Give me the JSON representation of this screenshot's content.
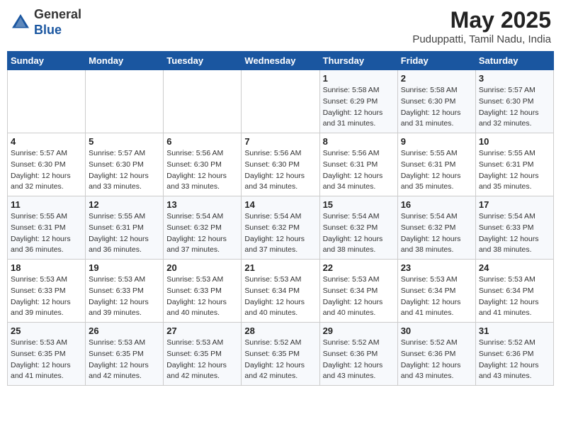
{
  "header": {
    "logo_general": "General",
    "logo_blue": "Blue",
    "month_year": "May 2025",
    "location": "Puduppatti, Tamil Nadu, India"
  },
  "days_of_week": [
    "Sunday",
    "Monday",
    "Tuesday",
    "Wednesday",
    "Thursday",
    "Friday",
    "Saturday"
  ],
  "weeks": [
    [
      {
        "day": "",
        "info": ""
      },
      {
        "day": "",
        "info": ""
      },
      {
        "day": "",
        "info": ""
      },
      {
        "day": "",
        "info": ""
      },
      {
        "day": "1",
        "info": "Sunrise: 5:58 AM\nSunset: 6:29 PM\nDaylight: 12 hours\nand 31 minutes."
      },
      {
        "day": "2",
        "info": "Sunrise: 5:58 AM\nSunset: 6:30 PM\nDaylight: 12 hours\nand 31 minutes."
      },
      {
        "day": "3",
        "info": "Sunrise: 5:57 AM\nSunset: 6:30 PM\nDaylight: 12 hours\nand 32 minutes."
      }
    ],
    [
      {
        "day": "4",
        "info": "Sunrise: 5:57 AM\nSunset: 6:30 PM\nDaylight: 12 hours\nand 32 minutes."
      },
      {
        "day": "5",
        "info": "Sunrise: 5:57 AM\nSunset: 6:30 PM\nDaylight: 12 hours\nand 33 minutes."
      },
      {
        "day": "6",
        "info": "Sunrise: 5:56 AM\nSunset: 6:30 PM\nDaylight: 12 hours\nand 33 minutes."
      },
      {
        "day": "7",
        "info": "Sunrise: 5:56 AM\nSunset: 6:30 PM\nDaylight: 12 hours\nand 34 minutes."
      },
      {
        "day": "8",
        "info": "Sunrise: 5:56 AM\nSunset: 6:31 PM\nDaylight: 12 hours\nand 34 minutes."
      },
      {
        "day": "9",
        "info": "Sunrise: 5:55 AM\nSunset: 6:31 PM\nDaylight: 12 hours\nand 35 minutes."
      },
      {
        "day": "10",
        "info": "Sunrise: 5:55 AM\nSunset: 6:31 PM\nDaylight: 12 hours\nand 35 minutes."
      }
    ],
    [
      {
        "day": "11",
        "info": "Sunrise: 5:55 AM\nSunset: 6:31 PM\nDaylight: 12 hours\nand 36 minutes."
      },
      {
        "day": "12",
        "info": "Sunrise: 5:55 AM\nSunset: 6:31 PM\nDaylight: 12 hours\nand 36 minutes."
      },
      {
        "day": "13",
        "info": "Sunrise: 5:54 AM\nSunset: 6:32 PM\nDaylight: 12 hours\nand 37 minutes."
      },
      {
        "day": "14",
        "info": "Sunrise: 5:54 AM\nSunset: 6:32 PM\nDaylight: 12 hours\nand 37 minutes."
      },
      {
        "day": "15",
        "info": "Sunrise: 5:54 AM\nSunset: 6:32 PM\nDaylight: 12 hours\nand 38 minutes."
      },
      {
        "day": "16",
        "info": "Sunrise: 5:54 AM\nSunset: 6:32 PM\nDaylight: 12 hours\nand 38 minutes."
      },
      {
        "day": "17",
        "info": "Sunrise: 5:54 AM\nSunset: 6:33 PM\nDaylight: 12 hours\nand 38 minutes."
      }
    ],
    [
      {
        "day": "18",
        "info": "Sunrise: 5:53 AM\nSunset: 6:33 PM\nDaylight: 12 hours\nand 39 minutes."
      },
      {
        "day": "19",
        "info": "Sunrise: 5:53 AM\nSunset: 6:33 PM\nDaylight: 12 hours\nand 39 minutes."
      },
      {
        "day": "20",
        "info": "Sunrise: 5:53 AM\nSunset: 6:33 PM\nDaylight: 12 hours\nand 40 minutes."
      },
      {
        "day": "21",
        "info": "Sunrise: 5:53 AM\nSunset: 6:34 PM\nDaylight: 12 hours\nand 40 minutes."
      },
      {
        "day": "22",
        "info": "Sunrise: 5:53 AM\nSunset: 6:34 PM\nDaylight: 12 hours\nand 40 minutes."
      },
      {
        "day": "23",
        "info": "Sunrise: 5:53 AM\nSunset: 6:34 PM\nDaylight: 12 hours\nand 41 minutes."
      },
      {
        "day": "24",
        "info": "Sunrise: 5:53 AM\nSunset: 6:34 PM\nDaylight: 12 hours\nand 41 minutes."
      }
    ],
    [
      {
        "day": "25",
        "info": "Sunrise: 5:53 AM\nSunset: 6:35 PM\nDaylight: 12 hours\nand 41 minutes."
      },
      {
        "day": "26",
        "info": "Sunrise: 5:53 AM\nSunset: 6:35 PM\nDaylight: 12 hours\nand 42 minutes."
      },
      {
        "day": "27",
        "info": "Sunrise: 5:53 AM\nSunset: 6:35 PM\nDaylight: 12 hours\nand 42 minutes."
      },
      {
        "day": "28",
        "info": "Sunrise: 5:52 AM\nSunset: 6:35 PM\nDaylight: 12 hours\nand 42 minutes."
      },
      {
        "day": "29",
        "info": "Sunrise: 5:52 AM\nSunset: 6:36 PM\nDaylight: 12 hours\nand 43 minutes."
      },
      {
        "day": "30",
        "info": "Sunrise: 5:52 AM\nSunset: 6:36 PM\nDaylight: 12 hours\nand 43 minutes."
      },
      {
        "day": "31",
        "info": "Sunrise: 5:52 AM\nSunset: 6:36 PM\nDaylight: 12 hours\nand 43 minutes."
      }
    ]
  ]
}
